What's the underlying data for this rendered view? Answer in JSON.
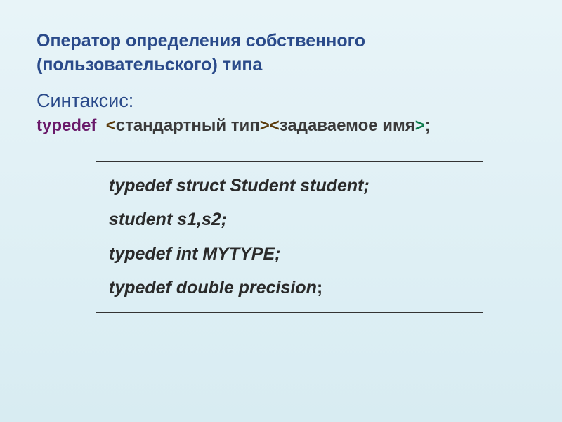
{
  "title": "Оператор определения собственного (пользовательского) типа",
  "syntax_label": "Синтаксис:",
  "syntax": {
    "keyword": "typedef",
    "lt1": "<",
    "std_type": "стандартный тип",
    "gt1": ">",
    "lt2": "<",
    "given_name": "задаваемое имя",
    "gt2": ">",
    "semi": ";"
  },
  "code": {
    "line1": "typedef struct Student student;",
    "line2": "student s1,s2;",
    "line3": "typedef  int MYTYPE;",
    "line4_a": "typedef double precision",
    "line4_b": ";"
  }
}
